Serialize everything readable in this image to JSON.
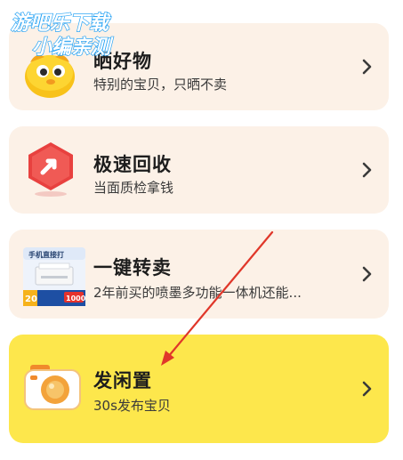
{
  "watermark": {
    "line1": "游吧乐下载",
    "line2": "小编亲测"
  },
  "items": [
    {
      "title": "晒好物",
      "subtitle": "特别的宝贝，只晒不卖",
      "icon": "yellow-mascot-icon"
    },
    {
      "title": "极速回收",
      "subtitle": "当面质检拿钱",
      "icon": "recycle-arrow-icon"
    },
    {
      "title": "一键转卖",
      "subtitle": "2年前买的喷墨多功能一体机还能...",
      "icon": "printer-thumbnail",
      "thumb": {
        "header": "手机直接打",
        "badge": "20",
        "price_tag": "1000"
      }
    },
    {
      "title": "发闲置",
      "subtitle": "30s发布宝贝",
      "icon": "camera-icon"
    }
  ],
  "colors": {
    "card_bg": "#fcf1e7",
    "highlight_bg": "#fde74c",
    "chevron": "#3a3a3a",
    "arrow": "#e0372a",
    "watermark_fill": "#ffffff",
    "watermark_stroke": "#2aa4f4"
  }
}
